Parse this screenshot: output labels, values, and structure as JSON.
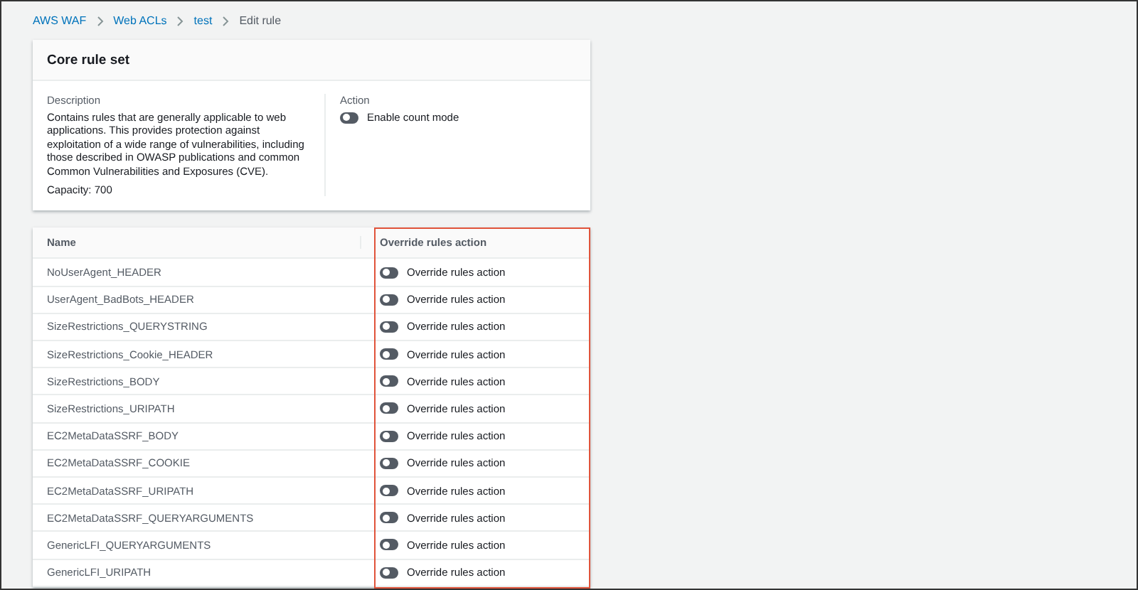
{
  "breadcrumb": [
    {
      "label": "AWS WAF",
      "link": true
    },
    {
      "label": "Web ACLs",
      "link": true
    },
    {
      "label": "test",
      "link": true
    },
    {
      "label": "Edit rule",
      "link": false
    }
  ],
  "rule_set": {
    "title": "Core rule set",
    "description_label": "Description",
    "description": "Contains rules that are generally applicable to web applications. This provides protection against exploitation of a wide range of vulnerabilities, including those described in OWASP publications and common Common Vulnerabilities and Exposures (CVE).",
    "capacity": "Capacity: 700",
    "action_label": "Action",
    "count_mode": {
      "label": "Enable count mode",
      "on": false
    }
  },
  "table": {
    "columns": [
      "Name",
      "Override rules action"
    ],
    "rows": [
      {
        "name": "NoUserAgent_HEADER",
        "toggle": "Override rules action",
        "on": false
      },
      {
        "name": "UserAgent_BadBots_HEADER",
        "toggle": "Override rules action",
        "on": false
      },
      {
        "name": "SizeRestrictions_QUERYSTRING",
        "toggle": "Override rules action",
        "on": false
      },
      {
        "name": "SizeRestrictions_Cookie_HEADER",
        "toggle": "Override rules action",
        "on": false
      },
      {
        "name": "SizeRestrictions_BODY",
        "toggle": "Override rules action",
        "on": false
      },
      {
        "name": "SizeRestrictions_URIPATH",
        "toggle": "Override rules action",
        "on": false
      },
      {
        "name": "EC2MetaDataSSRF_BODY",
        "toggle": "Override rules action",
        "on": false
      },
      {
        "name": "EC2MetaDataSSRF_COOKIE",
        "toggle": "Override rules action",
        "on": false
      },
      {
        "name": "EC2MetaDataSSRF_URIPATH",
        "toggle": "Override rules action",
        "on": false
      },
      {
        "name": "EC2MetaDataSSRF_QUERYARGUMENTS",
        "toggle": "Override rules action",
        "on": false
      },
      {
        "name": "GenericLFI_QUERYARGUMENTS",
        "toggle": "Override rules action",
        "on": false
      },
      {
        "name": "GenericLFI_URIPATH",
        "toggle": "Override rules action",
        "on": false
      }
    ]
  }
}
